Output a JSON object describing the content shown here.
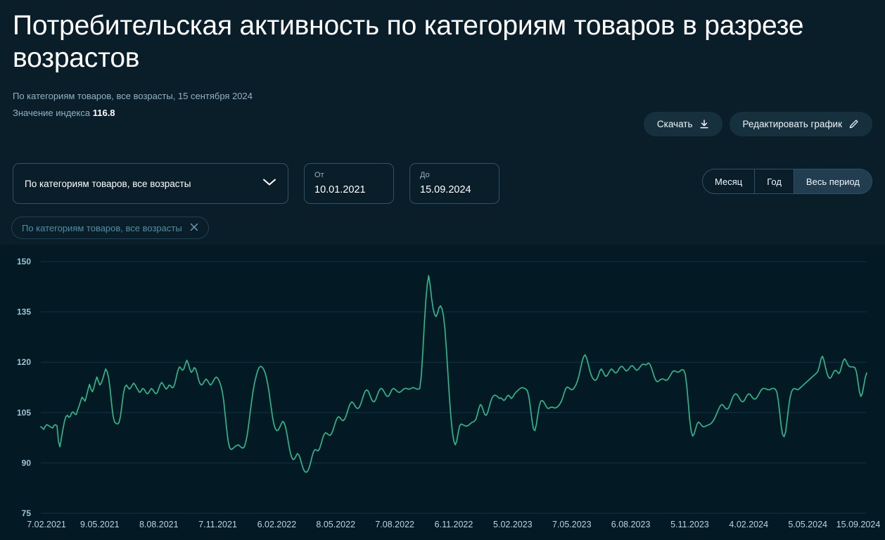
{
  "header": {
    "title": "Потребительская активность по категориям товаров в разрезе возрастов",
    "subtitle": "По категориям товаров, все возрасты, 15 сентября 2024",
    "index_label": "Значение индекса",
    "index_value": "116.8"
  },
  "actions": {
    "download_label": "Скачать",
    "download_icon": "download-icon",
    "edit_label": "Редактировать график",
    "edit_icon": "pencil-icon"
  },
  "filters": {
    "category_select": {
      "value": "По категориям товаров, все возрасты",
      "chevron_icon": "chevron-down-icon"
    },
    "date_from": {
      "label": "От",
      "value": "10.01.2021"
    },
    "date_to": {
      "label": "До",
      "value": "15.09.2024"
    },
    "chip": {
      "label": "По категориям товаров, все возрасты",
      "remove_icon": "close-icon"
    }
  },
  "period": {
    "options": [
      "Месяц",
      "Год",
      "Весь период"
    ],
    "selected": "Весь период"
  },
  "colors": {
    "background": "#051820",
    "chart_background": "#031a24",
    "header_background": "#0a1e29",
    "series": "#2dbd8e",
    "gridline": "#123243",
    "accent_border": "#2b5468",
    "active_fill": "#223d4f",
    "muted_text": "#8fb3c4"
  },
  "chart_data": {
    "type": "line",
    "title": "Потребительская активность по категориям товаров в разрезе возрастов",
    "xlabel": "",
    "ylabel": "",
    "ylim": [
      75,
      150
    ],
    "yticks": [
      75,
      90,
      105,
      120,
      135,
      150
    ],
    "grid": true,
    "legend": false,
    "xlim_labels": [
      "7.02.2021",
      "15.09.2024"
    ],
    "xticks": [
      "7.02.2021",
      "9.05.2021",
      "8.08.2021",
      "7.11.2021",
      "6.02.2022",
      "8.05.2022",
      "7.08.2022",
      "6.11.2022",
      "5.02.2023",
      "7.05.2023",
      "6.08.2023",
      "5.11.2023",
      "4.02.2024",
      "5.05.2024",
      "15.09.2024"
    ],
    "xtick_positions": [
      0,
      0.0714,
      0.1429,
      0.2143,
      0.2857,
      0.3571,
      0.4286,
      0.5,
      0.5714,
      0.6429,
      0.7143,
      0.7857,
      0.8571,
      0.9286,
      1.0
    ],
    "series": [
      {
        "name": "По категориям товаров, все возрасты",
        "color": "#2dbd8e",
        "last_value": 116.8,
        "max_value": 146.0,
        "min_value": 86.5,
        "values": [
          100.8,
          100.4,
          100.0,
          100.9,
          101.4,
          101.2,
          100.9,
          100.6,
          100.4,
          101.2,
          101.4,
          101.0,
          96.3,
          94.8,
          97.5,
          100.0,
          102.3,
          103.8,
          104.2,
          103.6,
          103.9,
          105.0,
          105.2,
          104.6,
          104.4,
          105.8,
          107.0,
          108.4,
          109.6,
          109.0,
          108.4,
          110.0,
          111.8,
          113.4,
          112.0,
          111.2,
          112.4,
          114.2,
          115.6,
          114.4,
          113.2,
          113.8,
          115.0,
          116.6,
          118.0,
          117.2,
          115.4,
          112.0,
          107.6,
          104.0,
          102.2,
          101.8,
          101.6,
          102.0,
          103.8,
          107.2,
          110.6,
          112.6,
          113.2,
          112.6,
          112.0,
          112.4,
          113.2,
          113.8,
          113.2,
          112.4,
          111.6,
          111.0,
          111.4,
          112.2,
          112.0,
          111.2,
          110.6,
          110.8,
          111.6,
          112.2,
          111.8,
          111.0,
          110.6,
          111.0,
          112.2,
          113.4,
          114.0,
          113.4,
          112.6,
          112.0,
          112.4,
          113.2,
          113.0,
          112.4,
          112.6,
          113.8,
          115.8,
          117.6,
          118.6,
          118.2,
          117.6,
          118.0,
          119.4,
          120.6,
          119.6,
          118.0,
          117.0,
          117.4,
          118.4,
          118.0,
          116.6,
          114.8,
          113.6,
          113.2,
          113.6,
          114.4,
          115.0,
          114.6,
          113.8,
          113.2,
          113.6,
          114.4,
          115.2,
          115.6,
          115.2,
          114.4,
          113.2,
          111.4,
          108.6,
          104.4,
          100.2,
          96.6,
          94.6,
          94.0,
          94.2,
          94.6,
          95.0,
          95.2,
          95.4,
          95.0,
          94.6,
          94.4,
          94.8,
          96.2,
          98.4,
          101.6,
          105.2,
          108.6,
          111.6,
          114.0,
          115.8,
          117.4,
          118.4,
          118.8,
          118.6,
          118.0,
          117.0,
          115.4,
          113.2,
          110.4,
          107.2,
          104.0,
          101.6,
          100.2,
          99.6,
          99.8,
          100.6,
          101.6,
          102.4,
          102.0,
          100.6,
          98.4,
          95.8,
          93.4,
          91.8,
          91.0,
          91.2,
          92.0,
          92.8,
          92.4,
          91.2,
          89.6,
          88.2,
          87.4,
          87.2,
          87.6,
          88.6,
          90.2,
          92.0,
          93.4,
          94.0,
          93.8,
          93.6,
          94.2,
          95.6,
          97.2,
          98.4,
          99.0,
          98.8,
          98.4,
          98.2,
          98.6,
          99.6,
          101.0,
          102.4,
          103.4,
          103.8,
          103.4,
          102.8,
          102.6,
          103.0,
          104.0,
          105.4,
          106.8,
          107.8,
          108.2,
          107.8,
          107.0,
          106.4,
          106.2,
          106.6,
          107.6,
          109.0,
          110.4,
          111.4,
          111.8,
          111.4,
          110.4,
          109.2,
          108.4,
          108.2,
          108.8,
          110.0,
          111.2,
          112.0,
          112.2,
          111.8,
          111.0,
          110.2,
          109.8,
          110.0,
          110.8,
          111.8,
          112.2,
          112.0,
          111.6,
          111.2,
          111.0,
          111.2,
          111.6,
          112.0,
          112.2,
          112.2,
          112.0,
          112.0,
          112.2,
          112.4,
          112.4,
          112.2,
          112.0,
          112.0,
          112.2,
          116.0,
          123.0,
          131.0,
          138.0,
          143.0,
          145.8,
          143.0,
          139.0,
          136.0,
          134.2,
          133.6,
          134.6,
          136.2,
          136.8,
          136.0,
          134.0,
          130.0,
          124.0,
          117.0,
          110.0,
          104.0,
          99.4,
          96.6,
          95.4,
          96.4,
          99.0,
          101.0,
          101.6,
          101.4,
          101.2,
          101.0,
          101.0,
          101.2,
          101.6,
          102.0,
          102.2,
          102.4,
          103.0,
          104.4,
          106.2,
          107.4,
          107.0,
          105.6,
          104.4,
          104.2,
          105.0,
          106.6,
          108.2,
          109.4,
          110.0,
          110.2,
          110.0,
          109.6,
          109.2,
          109.4,
          109.0,
          108.6,
          109.0,
          109.8,
          110.2,
          109.8,
          109.2,
          109.6,
          110.4,
          111.0,
          111.4,
          111.8,
          112.2,
          112.4,
          112.4,
          112.2,
          112.0,
          111.4,
          109.6,
          106.4,
          102.8,
          100.2,
          99.6,
          101.4,
          104.4,
          107.0,
          108.4,
          108.6,
          108.2,
          107.4,
          106.6,
          106.2,
          106.4,
          106.6,
          106.6,
          106.4,
          106.4,
          106.6,
          107.0,
          107.6,
          108.4,
          109.6,
          111.0,
          112.2,
          112.6,
          112.4,
          112.0,
          111.8,
          112.0,
          112.6,
          113.4,
          114.6,
          116.2,
          118.2,
          120.2,
          121.6,
          122.2,
          121.4,
          119.8,
          118.0,
          116.4,
          115.4,
          114.8,
          114.6,
          115.0,
          116.0,
          117.4,
          118.0,
          117.4,
          116.4,
          115.8,
          116.0,
          116.8,
          117.6,
          118.0,
          117.6,
          117.0,
          116.8,
          117.2,
          118.0,
          118.6,
          118.8,
          118.4,
          117.8,
          117.4,
          117.6,
          118.2,
          118.8,
          119.0,
          118.6,
          118.0,
          117.6,
          117.8,
          118.4,
          119.0,
          119.4,
          119.4,
          119.2,
          119.4,
          119.8,
          119.4,
          118.4,
          117.0,
          115.6,
          114.6,
          114.2,
          114.4,
          114.8,
          115.0,
          115.0,
          114.8,
          114.6,
          114.8,
          115.4,
          116.2,
          117.0,
          117.4,
          117.4,
          117.2,
          117.0,
          117.2,
          117.6,
          117.8,
          117.6,
          116.4,
          113.0,
          108.0,
          102.8,
          99.4,
          98.0,
          98.6,
          100.2,
          101.6,
          102.2,
          101.8,
          101.2,
          100.8,
          100.8,
          101.0,
          101.2,
          101.4,
          101.6,
          102.0,
          102.6,
          103.4,
          104.4,
          105.4,
          106.4,
          107.2,
          107.4,
          107.0,
          106.4,
          106.0,
          106.2,
          107.0,
          108.2,
          109.4,
          110.2,
          110.6,
          110.4,
          109.8,
          109.0,
          108.4,
          108.2,
          108.6,
          109.4,
          110.2,
          110.6,
          110.4,
          109.8,
          109.2,
          109.0,
          109.2,
          109.8,
          110.6,
          111.4,
          112.0,
          112.2,
          112.2,
          112.0,
          111.8,
          111.8,
          112.0,
          112.2,
          112.2,
          112.0,
          111.2,
          108.8,
          105.0,
          101.0,
          98.4,
          97.8,
          99.2,
          102.6,
          106.4,
          109.4,
          111.2,
          112.0,
          112.2,
          112.0,
          111.8,
          112.0,
          112.4,
          112.8,
          113.2,
          113.6,
          114.0,
          114.4,
          114.8,
          115.2,
          115.6,
          116.0,
          116.4,
          116.8,
          117.4,
          119.0,
          121.0,
          121.8,
          120.6,
          118.6,
          116.8,
          115.6,
          115.2,
          115.6,
          116.6,
          117.4,
          117.6,
          117.2,
          116.6,
          117.2,
          118.8,
          120.4,
          121.0,
          120.4,
          119.4,
          118.8,
          118.6,
          118.6,
          118.6,
          118.4,
          117.2,
          114.4,
          111.4,
          109.8,
          110.6,
          113.0,
          115.4,
          116.8
        ]
      }
    ]
  }
}
